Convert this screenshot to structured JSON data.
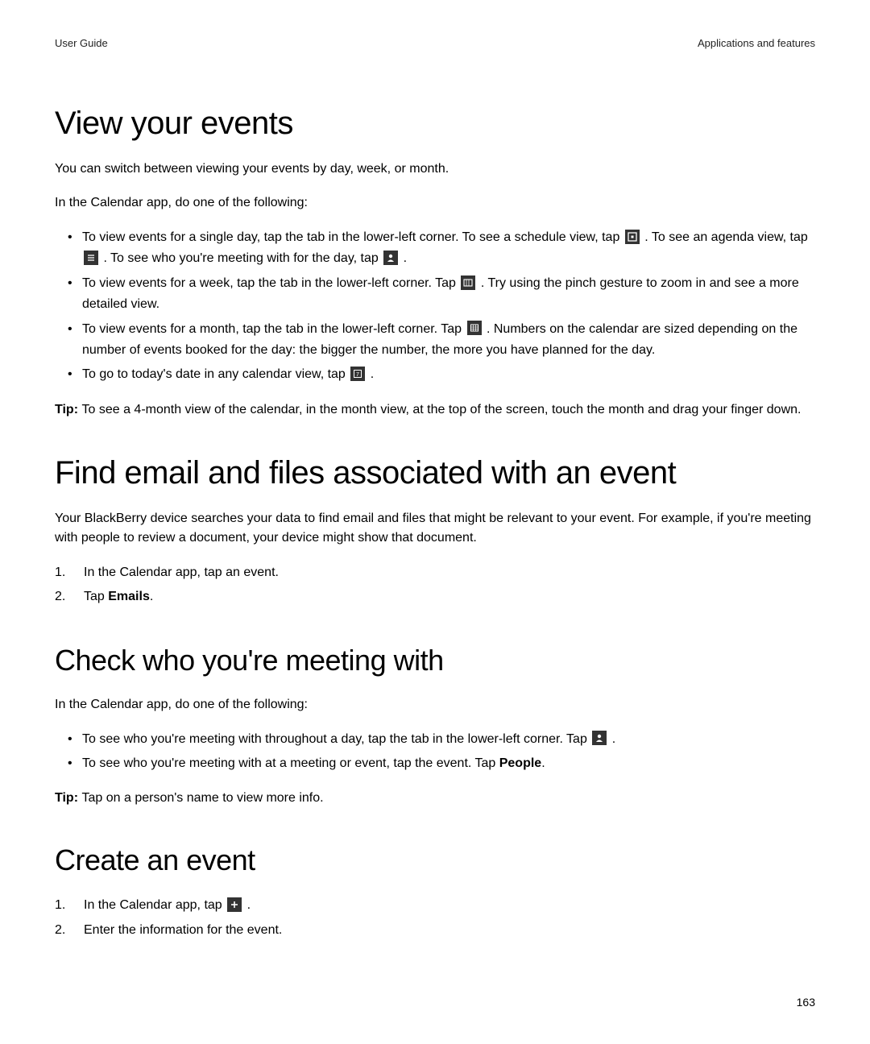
{
  "header": {
    "left": "User Guide",
    "right": "Applications and features"
  },
  "section1": {
    "title": "View your events",
    "p1": "You can switch between viewing your events by day, week, or month.",
    "p2": "In the Calendar app, do one of the following:",
    "b1a": "To view events for a single day, tap the tab in the lower-left corner. To see a schedule view, tap ",
    "b1b": " . To see an agenda view, tap ",
    "b1c": " . To see who you're meeting with for the day, tap ",
    "b1d": " .",
    "b2a": "To view events for a week, tap the tab in the lower-left corner. Tap ",
    "b2b": " . Try using the pinch gesture to zoom in and see a more detailed view.",
    "b3a": "To view events for a month, tap the tab in the lower-left corner. Tap ",
    "b3b": " . Numbers on the calendar are sized depending on the number of events booked for the day: the bigger the number, the more you have planned for the day.",
    "b4a": "To go to today's date in any calendar view, tap ",
    "b4b": " .",
    "tip_label": "Tip: ",
    "tip_text": "To see a 4-month view of the calendar, in the month view, at the top of the screen, touch the month and drag your finger down."
  },
  "section2": {
    "title": "Find email and files associated with an event",
    "p1": "Your BlackBerry device searches your data to find email and files that might be relevant to your event. For example, if you're meeting with people to review a document, your device might show that document.",
    "s1": "In the Calendar app, tap an event.",
    "s2a": "Tap ",
    "s2b": "Emails",
    "s2c": "."
  },
  "section3": {
    "title": "Check who you're meeting with",
    "p1": "In the Calendar app, do one of the following:",
    "b1a": "To see who you're meeting with throughout a day, tap the tab in the lower-left corner. Tap ",
    "b1b": " .",
    "b2a": "To see who you're meeting with at a meeting or event, tap the event. Tap ",
    "b2b": "People",
    "b2c": ".",
    "tip_label": "Tip: ",
    "tip_text": "Tap on a person's name to view more info."
  },
  "section4": {
    "title": "Create an event",
    "s1a": "In the Calendar app, tap ",
    "s1b": " .",
    "s2": "Enter the information for the event."
  },
  "page_number": "163"
}
